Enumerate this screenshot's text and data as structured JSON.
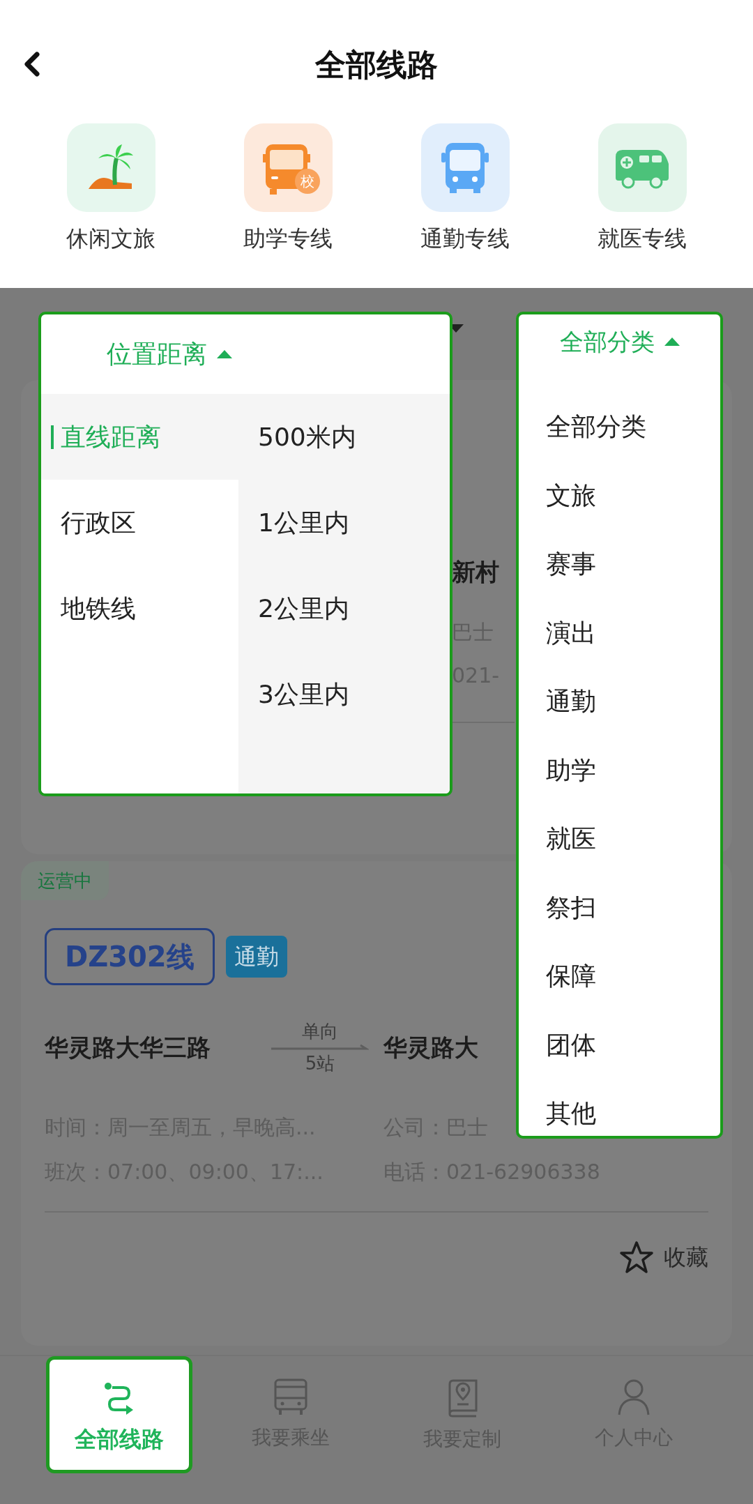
{
  "header": {
    "title": "全部线路"
  },
  "categories": [
    {
      "label": "休闲文旅",
      "kind": "leisure"
    },
    {
      "label": "助学专线",
      "kind": "school",
      "badge": "校"
    },
    {
      "label": "通勤专线",
      "kind": "commute"
    },
    {
      "label": "就医专线",
      "kind": "medical"
    }
  ],
  "distance_filter": {
    "label": "位置距离",
    "expanded": true,
    "modes": [
      {
        "label": "直线距离",
        "selected": true
      },
      {
        "label": "行政区",
        "selected": false
      },
      {
        "label": "地铁线",
        "selected": false
      }
    ],
    "options": [
      {
        "label": "500米内",
        "selected": false
      },
      {
        "label": "1公里内",
        "selected": false
      },
      {
        "label": "2公里内",
        "selected": false
      },
      {
        "label": "3公里内",
        "selected": false
      }
    ]
  },
  "category_filter": {
    "label": "全部分类",
    "expanded": true,
    "options": [
      {
        "label": "全部分类",
        "selected": false
      },
      {
        "label": "文旅",
        "selected": false
      },
      {
        "label": "赛事",
        "selected": false
      },
      {
        "label": "演出",
        "selected": false
      },
      {
        "label": "通勤",
        "selected": false
      },
      {
        "label": "助学",
        "selected": false
      },
      {
        "label": "就医",
        "selected": false
      },
      {
        "label": "祭扫",
        "selected": false
      },
      {
        "label": "保障",
        "selected": false
      },
      {
        "label": "团体",
        "selected": false
      },
      {
        "label": "其他",
        "selected": false
      }
    ]
  },
  "routes": [
    {
      "kind": "covered",
      "destination": "新村",
      "company": "巴士",
      "phone": "021-"
    },
    {
      "kind": "full",
      "status": "运营中",
      "name": "DZ302线",
      "tag": "通勤",
      "origin": "华灵路大华三路",
      "direction": "单向",
      "stops": "5站",
      "destination": "华灵路大",
      "time": "时间：周一至周五，早晚高...",
      "company": "公司：巴士",
      "schedule": "班次：07:00、09:00、17:...",
      "phone": "电话：021-62906338",
      "favorite_label": "收藏",
      "favorited": false
    }
  ],
  "bottom_nav": [
    {
      "label": "全部线路",
      "kind": "route",
      "selected": true
    },
    {
      "label": "我要乘坐",
      "kind": "bus",
      "selected": false
    },
    {
      "label": "我要定制",
      "kind": "book",
      "selected": false
    },
    {
      "label": "个人中心",
      "kind": "person",
      "selected": false
    }
  ]
}
